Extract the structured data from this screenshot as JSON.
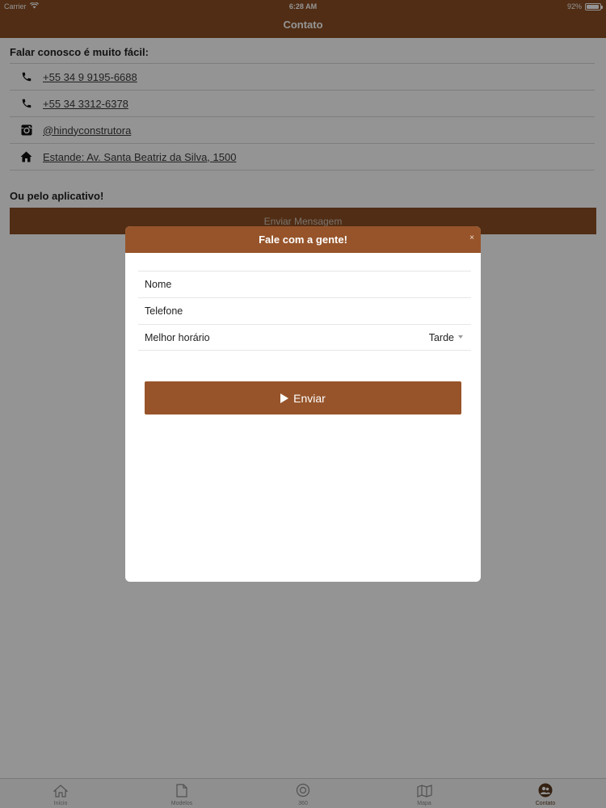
{
  "status": {
    "carrier": "Carrier",
    "time": "6:28 AM",
    "battery": "92%"
  },
  "nav": {
    "title": "Contato"
  },
  "contact": {
    "intro": "Falar conosco é muito fácil:",
    "items": [
      {
        "icon": "phone-icon",
        "text": "+55 34 9 9195-6688"
      },
      {
        "icon": "phone-icon",
        "text": "+55 34 3312-6378"
      },
      {
        "icon": "instagram-icon",
        "text": "@hindyconstrutora"
      },
      {
        "icon": "home-icon",
        "text": "Estande: Av. Santa Beatriz da Silva, 1500"
      }
    ],
    "app_heading": "Ou pelo aplicativo!",
    "send_message_label": "Enviar Mensagem"
  },
  "modal": {
    "title": "Fale com a gente!",
    "close": "×",
    "fields": {
      "name": "Nome",
      "phone": "Telefone",
      "best_time": "Melhor horário"
    },
    "best_time_value": "Tarde",
    "submit_label": "Enviar"
  },
  "tabbar": {
    "items": [
      {
        "label": "Início",
        "icon": "home-icon"
      },
      {
        "label": "Modelos",
        "icon": "document-icon"
      },
      {
        "label": "360",
        "icon": "360-icon"
      },
      {
        "label": "Mapa",
        "icon": "map-icon"
      },
      {
        "label": "Contato",
        "icon": "contact-icon"
      }
    ]
  },
  "colors": {
    "brand": "#8a4e24",
    "modal_header": "#97542a"
  }
}
